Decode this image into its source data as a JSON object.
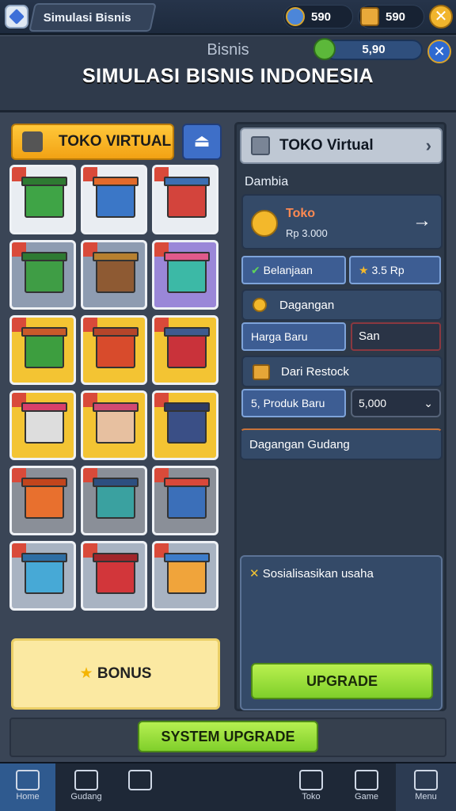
{
  "topbar": {
    "app_name": "Simulasi Bisnis",
    "coins": "590",
    "gold": "590"
  },
  "header": {
    "subtitle": "Bisnis",
    "title": "SIMULASI BISNIS INDONESIA",
    "money": "5,90"
  },
  "left": {
    "store_tab": "TOKO VIRTUAL",
    "tiles": [
      {
        "color": "#e9edf2",
        "bld": "#3fa446",
        "roof": "#2e7a32"
      },
      {
        "color": "#e9edf2",
        "bld": "#3b77c7",
        "roof": "#e26a2a"
      },
      {
        "color": "#e9edf2",
        "bld": "#d3443c",
        "roof": "#3c6fb3"
      },
      {
        "color": "#8e9cb1",
        "bld": "#3f9d45",
        "roof": "#2e7a32"
      },
      {
        "color": "#8e9cb1",
        "bld": "#8e5a33",
        "roof": "#b7802f"
      },
      {
        "color": "#9a87d8",
        "bld": "#3cb9a6",
        "roof": "#e05a8b"
      },
      {
        "color": "#f3c433",
        "bld": "#3d9e3f",
        "roof": "#c85a2a"
      },
      {
        "color": "#f3c433",
        "bld": "#d84b2c",
        "roof": "#b5452a"
      },
      {
        "color": "#f3c433",
        "bld": "#c9323a",
        "roof": "#3e5b8f"
      },
      {
        "color": "#f3c433",
        "bld": "#ddd",
        "roof": "#d9406a"
      },
      {
        "color": "#f3c433",
        "bld": "#e7c0a0",
        "roof": "#d14a72"
      },
      {
        "color": "#f3c433",
        "bld": "#3a4f86",
        "roof": "#2c3a63"
      },
      {
        "color": "#8a8f98",
        "bld": "#e8702e",
        "roof": "#c2451c"
      },
      {
        "color": "#8a8f98",
        "bld": "#3aa1a0",
        "roof": "#2d4f80"
      },
      {
        "color": "#8a8f98",
        "bld": "#3b6fb9",
        "roof": "#d9483a"
      },
      {
        "color": "#a8b3c2",
        "bld": "#47a9d6",
        "roof": "#2e6ea3"
      },
      {
        "color": "#a8b3c2",
        "bld": "#d2363a",
        "roof": "#a1262b"
      },
      {
        "color": "#a8b3c2",
        "bld": "#f0a43b",
        "roof": "#3d7cc9"
      }
    ],
    "bonus_label": "BONUS"
  },
  "right": {
    "panel_title": "TOKO Virtual",
    "section_label": "Dambia",
    "promo_title": "Toko",
    "promo_sub": "Rp 3.000",
    "btn1": "Belanjaan",
    "btn2": "3.5 Rp",
    "row_label": "Dagangan",
    "field1": "Harga Baru",
    "field2": "San",
    "restock_label": "Dari Restock",
    "field3": "5, Produk Baru",
    "select_value": "5,000",
    "section2": "Dagangan Gudang",
    "notice": "Sosialisasikan usaha",
    "upgrade_btn": "UPGRADE"
  },
  "system_btn": "SYSTEM UPGRADE",
  "nav": [
    {
      "label": "Home"
    },
    {
      "label": "Gudang"
    },
    {
      "label": ""
    },
    {
      "label": "Toko"
    },
    {
      "label": "Game"
    },
    {
      "label": "Menu"
    }
  ]
}
